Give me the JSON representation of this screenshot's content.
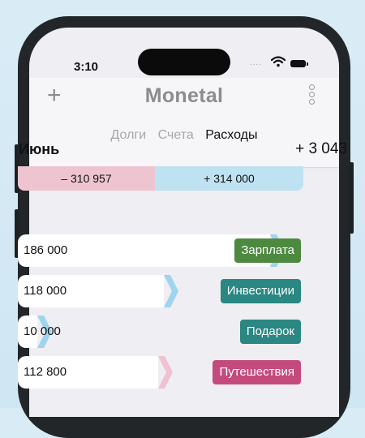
{
  "status_bar": {
    "time": "3:10",
    "signal": "....",
    "wifi_icon": "wifi-icon",
    "battery_icon": "battery-icon"
  },
  "header": {
    "add_icon": "plus-icon",
    "add_label": "+",
    "title": "Monetal",
    "menu_icon": "more-vertical-icon",
    "tabs": [
      {
        "label": "Долги",
        "active": false
      },
      {
        "label": "Счета",
        "active": false
      },
      {
        "label": "Расходы",
        "active": true
      }
    ]
  },
  "summary": {
    "month": "Июнь",
    "total": "+ 3 043",
    "expense": "– 310 957",
    "income": "+ 314 000",
    "expense_color": "#efc4d1",
    "income_color": "#bfe2f2"
  },
  "items": [
    {
      "amount": "186 000",
      "category": "Зарплата",
      "color": "#4d8a40",
      "fill": 0.95,
      "chevron_color": "#9fd4ef"
    },
    {
      "amount": "118 000",
      "category": "Инвестиции",
      "color": "#2a8782",
      "fill": 0.55,
      "chevron_color": "#9fd4ef"
    },
    {
      "amount": "10 000",
      "category": "Подарок",
      "color": "#2a8782",
      "fill": 0.07,
      "chevron_color": "#9fd4ef"
    },
    {
      "amount": "112 800",
      "category": "Путешествия",
      "color": "#c44a7e",
      "fill": 0.53,
      "chevron_color": "#f0c1cf"
    }
  ]
}
